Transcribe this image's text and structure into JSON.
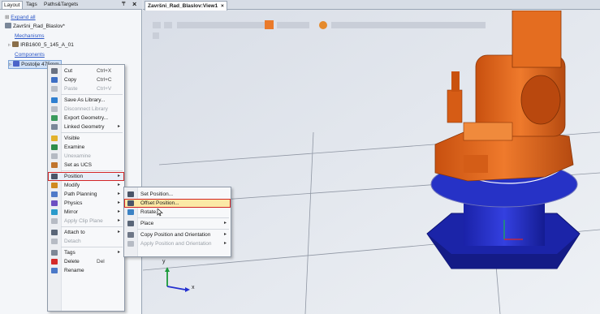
{
  "left_panel": {
    "tabs": [
      "Layout",
      "Tags",
      "Paths&Targets"
    ],
    "pin_icon": "pin-icon",
    "close_symbol": "×",
    "expand_all": "Expand all",
    "station": "Završni_Rad_Blaslov*",
    "mechanisms_header": "Mechanisms",
    "robot": "IRB1600_5_145_A_01",
    "components_header": "Components",
    "component": "Postolje 475mm"
  },
  "view": {
    "tab_title": "Završni_Rad_Blaslov:View1",
    "tab_close": "×",
    "axis_y": "y",
    "axis_x": "x"
  },
  "context_menu": {
    "items": [
      {
        "label": "Cut",
        "shortcut": "Ctrl+X",
        "icon": "scissors-icon",
        "enabled": true
      },
      {
        "label": "Copy",
        "shortcut": "Ctrl+C",
        "icon": "copy-icon",
        "enabled": true
      },
      {
        "label": "Paste",
        "shortcut": "Ctrl+V",
        "icon": "paste-icon",
        "enabled": false
      },
      {
        "label": "Save As Library...",
        "icon": "library-icon",
        "enabled": true
      },
      {
        "label": "Disconnect Library",
        "icon": "disconnect-library-icon",
        "enabled": false
      },
      {
        "label": "Export Geometry...",
        "icon": "export-geometry-icon",
        "enabled": true
      },
      {
        "label": "Linked Geometry",
        "icon": "linked-geometry-icon",
        "enabled": true,
        "submenu": true
      },
      {
        "label": "Visible",
        "icon": "checkmark-icon",
        "enabled": true
      },
      {
        "label": "Examine",
        "icon": "examine-icon",
        "enabled": true
      },
      {
        "label": "Unexamine",
        "icon": "unexamine-icon",
        "enabled": false
      },
      {
        "label": "Set as UCS",
        "icon": "ucs-icon",
        "enabled": true
      },
      {
        "label": "Position",
        "icon": "position-icon",
        "enabled": true,
        "submenu": true
      },
      {
        "label": "Modify",
        "icon": "modify-icon",
        "enabled": true,
        "submenu": true
      },
      {
        "label": "Path Planning",
        "icon": "path-planning-icon",
        "enabled": true,
        "submenu": true
      },
      {
        "label": "Physics",
        "icon": "physics-icon",
        "enabled": true,
        "submenu": true
      },
      {
        "label": "Mirror",
        "icon": "mirror-icon",
        "enabled": true,
        "submenu": true
      },
      {
        "label": "Apply Clip Plane",
        "icon": "clip-plane-icon",
        "enabled": false,
        "submenu": true
      },
      {
        "label": "Attach to",
        "icon": "attach-icon",
        "enabled": true,
        "submenu": true
      },
      {
        "label": "Detach",
        "icon": "detach-icon",
        "enabled": false
      },
      {
        "label": "Tags",
        "icon": "tags-icon",
        "enabled": true,
        "submenu": true
      },
      {
        "label": "Delete",
        "shortcut": "Del",
        "icon": "delete-icon",
        "enabled": true
      },
      {
        "label": "Rename",
        "icon": "rename-icon",
        "enabled": true
      }
    ]
  },
  "position_submenu": {
    "items": [
      {
        "label": "Set Position...",
        "icon": "set-position-icon",
        "enabled": true
      },
      {
        "label": "Offset Position...",
        "icon": "offset-position-icon",
        "enabled": true
      },
      {
        "label": "Rotate...",
        "icon": "rotate-icon",
        "enabled": true
      },
      {
        "label": "Place",
        "icon": "place-icon",
        "enabled": true,
        "submenu": true
      },
      {
        "label": "Copy Position and Orientation",
        "icon": "copy-orientation-icon",
        "enabled": true,
        "submenu": true
      },
      {
        "label": "Apply Position and Orientation",
        "icon": "apply-orientation-icon",
        "enabled": false,
        "submenu": true
      }
    ]
  },
  "colors": {
    "robot_orange": "#e8651c",
    "pedestal_blue": "#2430c8",
    "highlight_red": "#d32626",
    "hover_yellow": "#fbe9a6"
  }
}
